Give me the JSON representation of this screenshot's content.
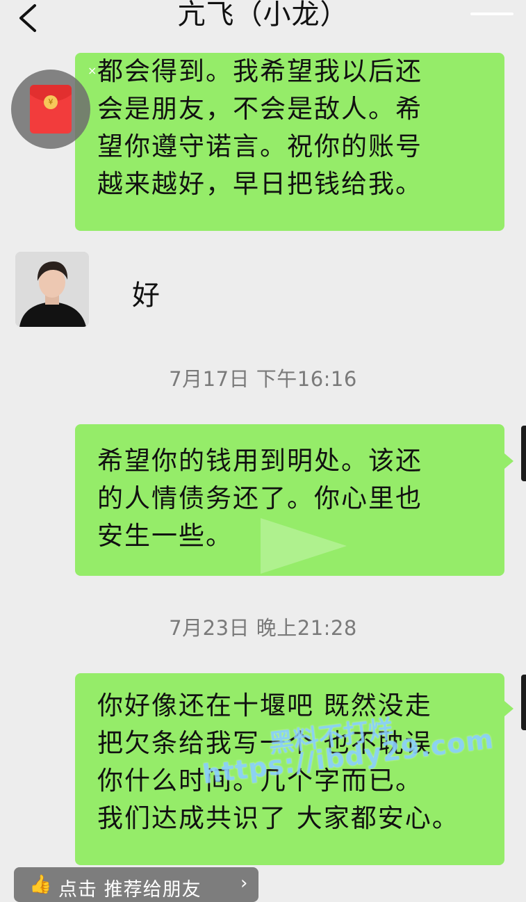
{
  "header": {
    "title": "亢飞（小龙）"
  },
  "messages": [
    {
      "side": "right",
      "text": "都会得到。我希望我以后还\n会是朋友，不会是敌人。希\n望你遵守诺言。祝你的账号\n越来越好，早日把钱给我。"
    },
    {
      "side": "left",
      "text": "好"
    },
    {
      "timestamp": "7月17日 下午16:16"
    },
    {
      "side": "right",
      "text": "希望你的钱用到明处。该还\n的人情债务还了。你心里也\n安生一些。"
    },
    {
      "timestamp": "7月23日 晚上21:28"
    },
    {
      "side": "right",
      "text": "你好像还在十堰吧 既然没走\n把欠条给我写一个 也不耽误\n你什么时间。几个字而已。\n我们达成共识了 大家都安心。"
    }
  ],
  "float_widget": {
    "icon": "red-envelope-icon",
    "coin": "¥",
    "close": "×"
  },
  "watermark": {
    "line1": "黑料不打烊",
    "line2": "https://ibdy29.com"
  },
  "recommend_bar": {
    "label": "点击 推荐给朋友",
    "chevron": "›"
  },
  "colors": {
    "bubble": "#95ec69",
    "background": "#ededed",
    "timestamp": "#7a7a7a"
  }
}
